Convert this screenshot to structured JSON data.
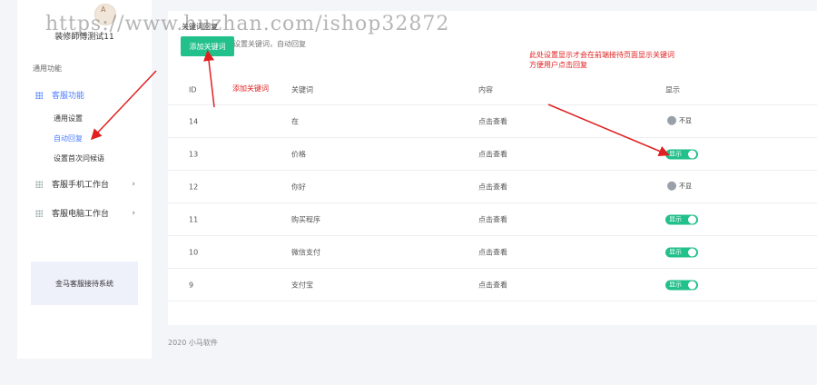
{
  "watermark": "https://www.huzhan.com/ishop32872",
  "sidebar": {
    "avatar_badge": "A",
    "username": "装修師傅测试11",
    "section_title": "通用功能",
    "menu": [
      {
        "label": "客服功能",
        "active": true
      },
      {
        "label": "客服手机工作台",
        "chevron": "›"
      },
      {
        "label": "客服电脑工作台",
        "chevron": "›"
      }
    ],
    "submenu": [
      {
        "label": "通用设置"
      },
      {
        "label": "自动回复",
        "active": true
      },
      {
        "label": "设置首次问候语"
      }
    ],
    "promo": "金马客服接待系统"
  },
  "main": {
    "crumb": "关键词回复",
    "hint": "设置关键词，自动回复",
    "add_button": "添加关键词",
    "columns": [
      "ID",
      "关键词",
      "内容",
      "显示"
    ],
    "rows": [
      {
        "id": "14",
        "keyword": "在",
        "content": "点击查看",
        "show": "不显",
        "on": false
      },
      {
        "id": "13",
        "keyword": "价格",
        "content": "点击查看",
        "show": "显示",
        "on": true
      },
      {
        "id": "12",
        "keyword": "你好",
        "content": "点击查看",
        "show": "不显",
        "on": false
      },
      {
        "id": "11",
        "keyword": "购买程序",
        "content": "点击查看",
        "show": "显示",
        "on": true
      },
      {
        "id": "10",
        "keyword": "微信支付",
        "content": "点击查看",
        "show": "显示",
        "on": true
      },
      {
        "id": "9",
        "keyword": "支付宝",
        "content": "点击查看",
        "show": "显示",
        "on": true
      }
    ]
  },
  "footer": "2020 小马软件",
  "annotations": {
    "add_keyword": "添加关键词",
    "display_note_line1": "此处设置显示才会在前端接待页面显示关键词",
    "display_note_line2": "方便用户点击回复"
  },
  "colors": {
    "accent": "#22c08a",
    "active": "#4a7cff",
    "annotation": "#e02020"
  }
}
